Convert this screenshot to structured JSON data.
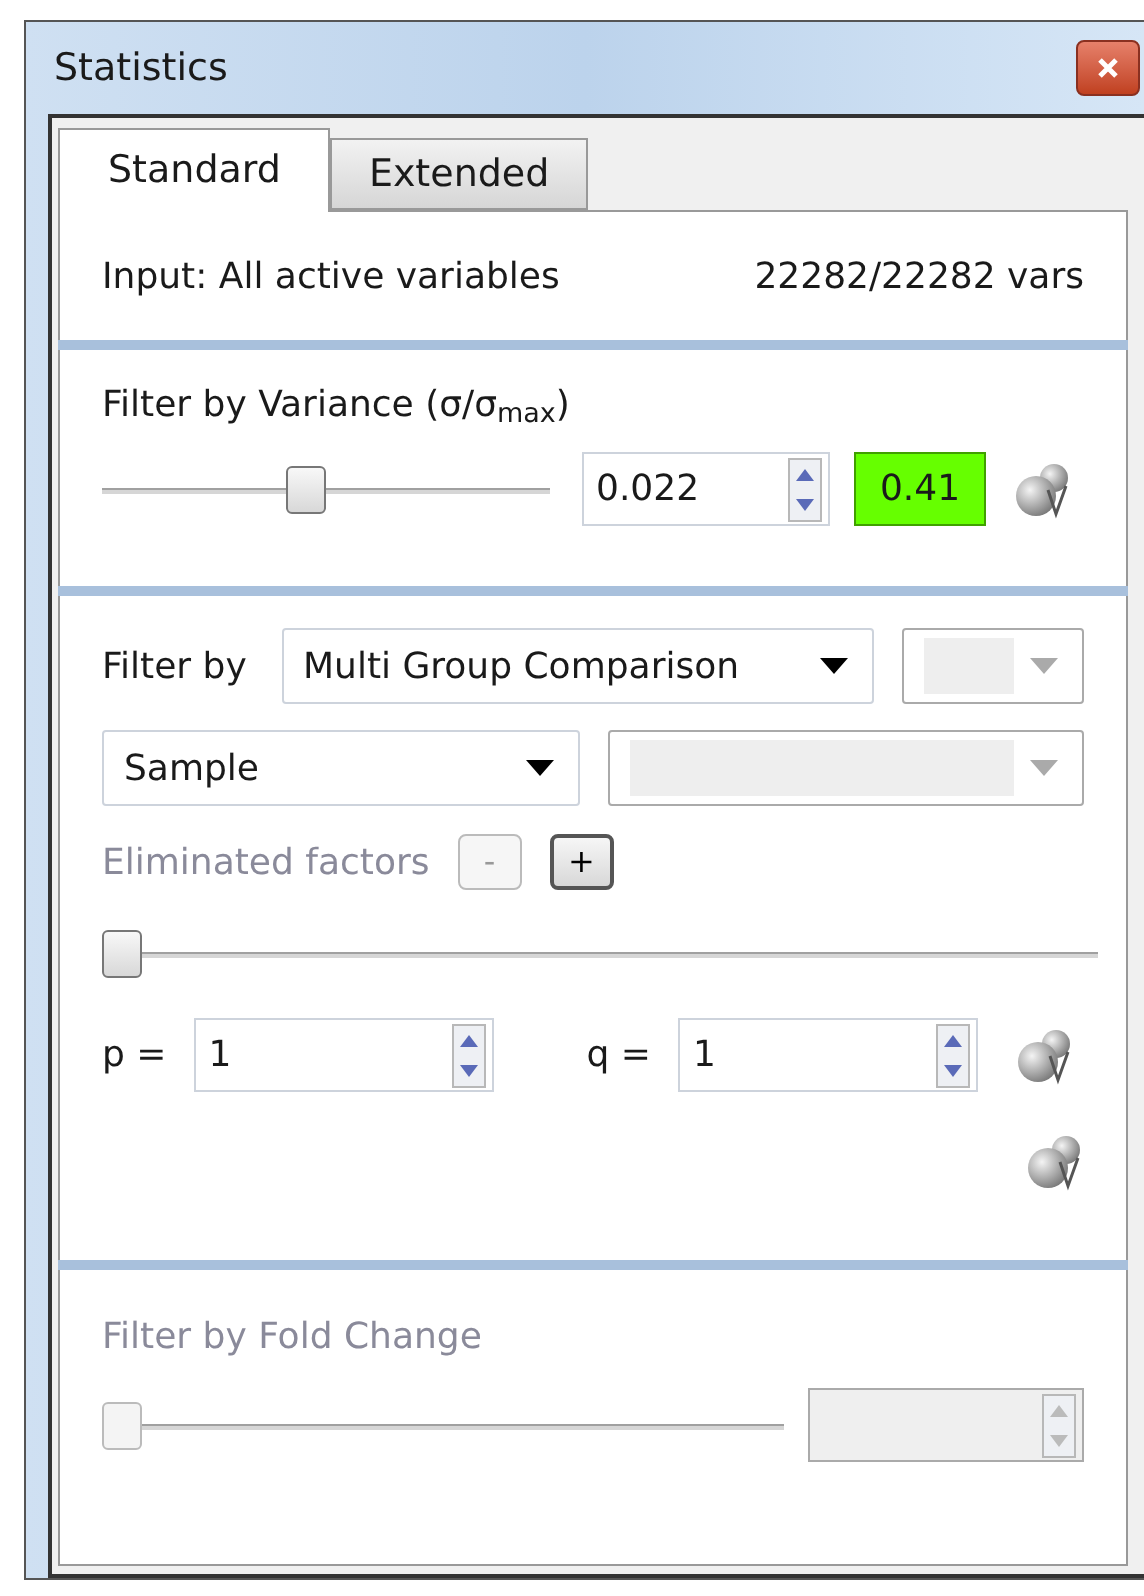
{
  "window": {
    "title": "Statistics"
  },
  "tabs": [
    {
      "label": "Standard",
      "selected": true
    },
    {
      "label": "Extended",
      "selected": false
    }
  ],
  "input": {
    "label": "Input: All active variables",
    "count": "22282/22282 vars"
  },
  "variance": {
    "label": "Filter by Variance (σ/σ$_{max}$)",
    "level": 0.45,
    "value": "0.022",
    "result": "0.41"
  },
  "group_filter": {
    "label": "Filter by",
    "method": "Multi Group Comparison",
    "factor": "Sample",
    "eliminated": {
      "label": "Eliminated factors",
      "disabled": true
    },
    "factor_buttons": [
      {
        "label": "-",
        "disabled": true
      },
      {
        "label": "+",
        "disabled": false
      }
    ],
    "level": 0,
    "params": [
      {
        "label": "p =",
        "value": "1"
      },
      {
        "label": "q =",
        "value": "1"
      }
    ]
  },
  "fold_change": {
    "label": "Filter by Fold Change",
    "disabled": true,
    "level": 0
  }
}
